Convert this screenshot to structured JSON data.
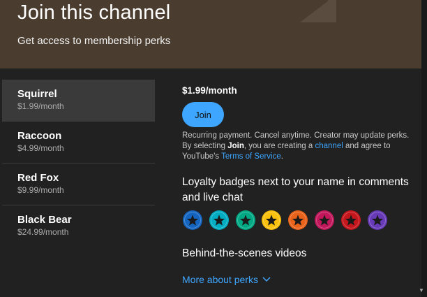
{
  "header": {
    "title": "Join this channel",
    "subtitle": "Get access to membership perks"
  },
  "tiers": [
    {
      "name": "Squirrel",
      "price": "$1.99/month",
      "selected": true
    },
    {
      "name": "Raccoon",
      "price": "$4.99/month",
      "selected": false
    },
    {
      "name": "Red Fox",
      "price": "$9.99/month",
      "selected": false
    },
    {
      "name": "Black Bear",
      "price": "$24.99/month",
      "selected": false
    }
  ],
  "detail": {
    "price": "$1.99/month",
    "join_label": "Join",
    "fine_print_1": "Recurring payment. Cancel anytime. Creator may update perks.",
    "fine_print_2_pre": "By selecting ",
    "fine_print_2_bold": "Join",
    "fine_print_2_mid": ", you are creating a ",
    "fine_print_2_link1": "channel",
    "fine_print_2_mid2": " and agree to YouTube's ",
    "fine_print_2_link2": "Terms of Service",
    "fine_print_2_end": "."
  },
  "perks": {
    "badges_title": "Loyalty badges next to your name in comments and live chat",
    "badge_icon": "star-badge-icon",
    "badge_colors": [
      "#1565c0",
      "#00acc1",
      "#00a884",
      "#f9c00c",
      "#e8621a",
      "#c2185b",
      "#c4161c",
      "#673ab7"
    ],
    "videos_title": "Behind-the-scenes videos",
    "more_label": "More about perks",
    "more_icon": "chevron-down-icon"
  },
  "colors": {
    "header_bg": "#4a3d30",
    "panel_bg": "#212121",
    "accent": "#3ea6ff"
  }
}
